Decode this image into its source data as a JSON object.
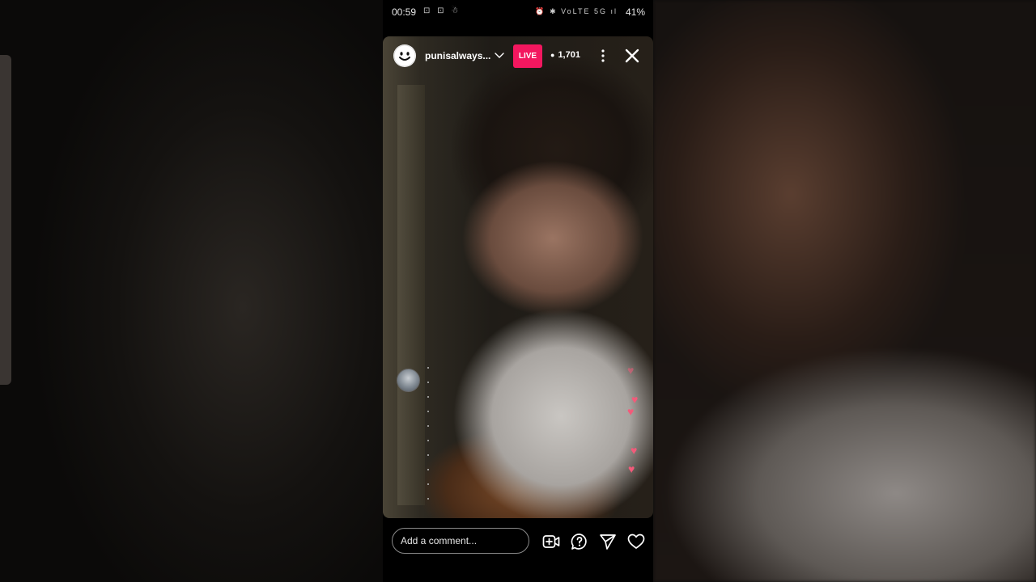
{
  "status_bar": {
    "time": "00:59",
    "left_icons": "⊡ ⊡ ☃",
    "right_icons": "⏰ ✱ VoLTE 5G ıl",
    "battery": "41%"
  },
  "live_header": {
    "username": "punisalways...",
    "live_label": "LIVE",
    "viewer_count": "1,701"
  },
  "comment_bar": {
    "placeholder": "Add a comment..."
  },
  "icons": {
    "avatar": "smiley-avatar-icon",
    "dropdown": "chevron-down-icon",
    "viewers": "eye-icon",
    "more": "more-vertical-icon",
    "close": "close-icon",
    "add_guest": "video-add-icon",
    "question": "question-bubble-icon",
    "share": "send-icon",
    "like": "heart-icon"
  },
  "colors": {
    "live_badge": "#f3175f",
    "floating_hearts": "#f25b7a"
  }
}
